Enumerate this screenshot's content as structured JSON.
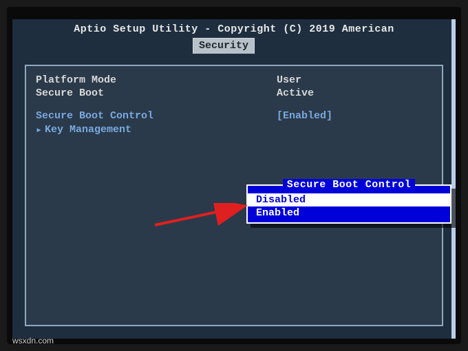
{
  "header": {
    "title": "Aptio Setup Utility - Copyright (C) 2019 American"
  },
  "tabs": {
    "active": "Security"
  },
  "info": {
    "platform_mode_label": "Platform Mode",
    "platform_mode_value": "User",
    "secure_boot_label": "Secure Boot",
    "secure_boot_value": "Active"
  },
  "settings": {
    "secure_boot_control_label": "Secure Boot Control",
    "secure_boot_control_value": "[Enabled]",
    "key_management_label": "Key Management",
    "submenu_indicator": "▸"
  },
  "popup": {
    "title": "Secure Boot Control",
    "options": [
      "Disabled",
      "Enabled"
    ],
    "selected_index": 0
  },
  "watermark": "wsxdn.com"
}
